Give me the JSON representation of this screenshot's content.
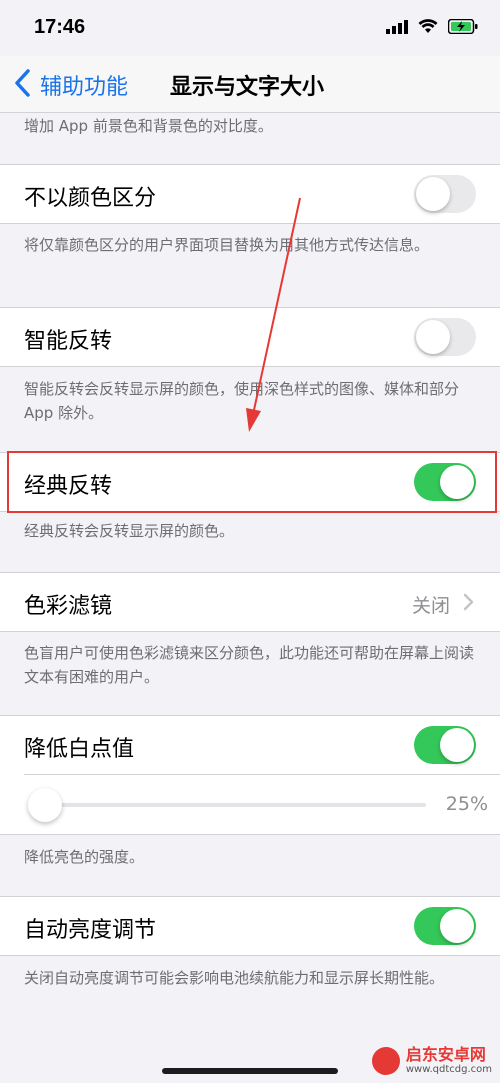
{
  "status": {
    "time": "17:46"
  },
  "nav": {
    "back_label": "辅助功能",
    "title": "显示与文字大小"
  },
  "top_desc": "增加 App 前景色和背景色的对比度。",
  "differentiate": {
    "label": "不以颜色区分",
    "desc": "将仅靠颜色区分的用户界面项目替换为用其他方式传达信息。",
    "on": false
  },
  "smart_invert": {
    "label": "智能反转",
    "desc": "智能反转会反转显示屏的颜色，使用深色样式的图像、媒体和部分 App 除外。",
    "on": false
  },
  "classic_invert": {
    "label": "经典反转",
    "desc": "经典反转会反转显示屏的颜色。",
    "on": true
  },
  "color_filters": {
    "label": "色彩滤镜",
    "value": "关闭",
    "desc": "色盲用户可使用色彩滤镜来区分颜色，此功能还可帮助在屏幕上阅读文本有困难的用户。"
  },
  "reduce_white": {
    "label": "降低白点值",
    "on": true,
    "slider_value": "25%",
    "slider_fraction": 0.0,
    "desc": "降低亮色的强度。"
  },
  "auto_brightness": {
    "label": "自动亮度调节",
    "on": true,
    "desc": "关闭自动亮度调节可能会影响电池续航能力和显示屏长期性能。"
  },
  "watermark": {
    "title": "启东安卓网",
    "sub": "www.qdtcdg.com"
  },
  "colors": {
    "accent": "#1a73e8",
    "toggle_on": "#34c759",
    "annotation": "#e53935"
  }
}
